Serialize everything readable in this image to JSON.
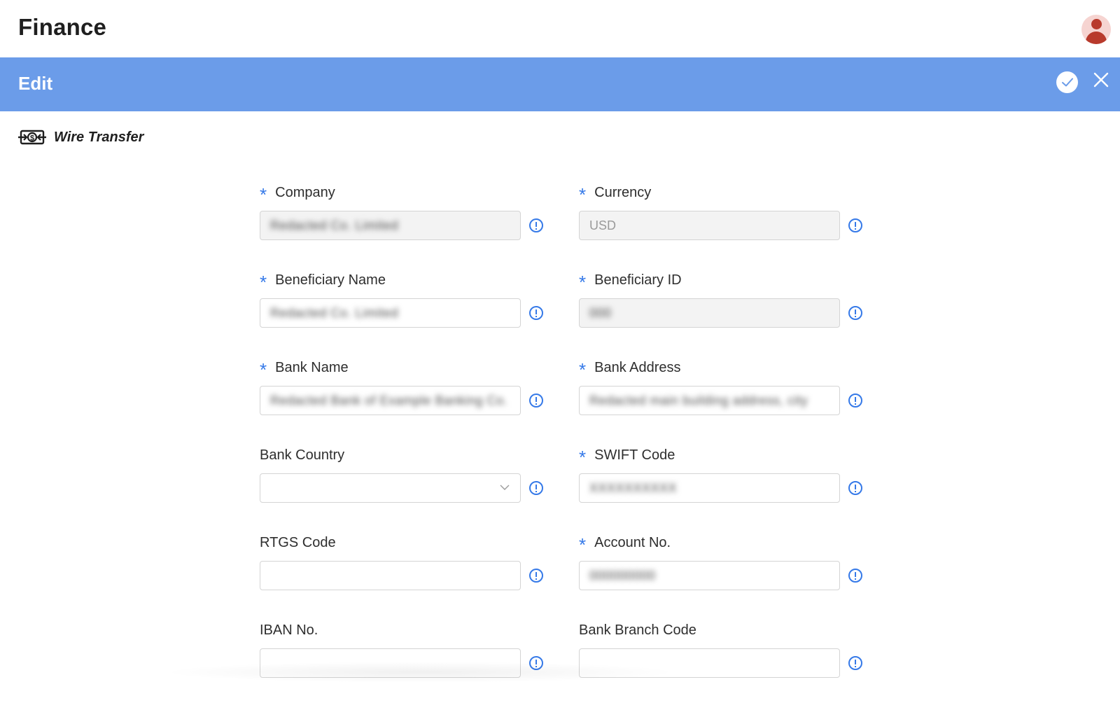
{
  "app": {
    "title": "Finance"
  },
  "edit_bar": {
    "title": "Edit"
  },
  "section": {
    "title": "Wire Transfer",
    "icon": "money-transfer-icon"
  },
  "form": {
    "company": {
      "label": "Company",
      "required": true,
      "value": "Redacted Co. Limited",
      "disabled": true
    },
    "currency": {
      "label": "Currency",
      "required": true,
      "value": "USD",
      "disabled": true
    },
    "beneficiary_name": {
      "label": "Beneficiary Name",
      "required": true,
      "value": "Redacted Co. Limited",
      "disabled": false
    },
    "beneficiary_id": {
      "label": "Beneficiary ID",
      "required": true,
      "value": "000",
      "disabled": true
    },
    "bank_name": {
      "label": "Bank Name",
      "required": true,
      "value": "Redacted Bank of Example Banking Co.",
      "disabled": false
    },
    "bank_address": {
      "label": "Bank Address",
      "required": true,
      "value": "Redacted main building address, city",
      "disabled": false
    },
    "bank_country": {
      "label": "Bank Country",
      "required": false,
      "value": "",
      "type": "select"
    },
    "swift_code": {
      "label": "SWIFT Code",
      "required": true,
      "value": "XXXXXXXXXX",
      "disabled": false
    },
    "rtgs_code": {
      "label": "RTGS Code",
      "required": false,
      "value": ""
    },
    "account_no": {
      "label": "Account No.",
      "required": true,
      "value": "000000000",
      "disabled": false
    },
    "iban_no": {
      "label": "IBAN No.",
      "required": false,
      "value": ""
    },
    "bank_branch_code": {
      "label": "Bank Branch Code",
      "required": false,
      "value": ""
    }
  },
  "colors": {
    "header_bar": "#6b9ce9",
    "required_mark": "#3579e8",
    "info_icon": "#3579e8",
    "avatar": "#b83a2c"
  }
}
